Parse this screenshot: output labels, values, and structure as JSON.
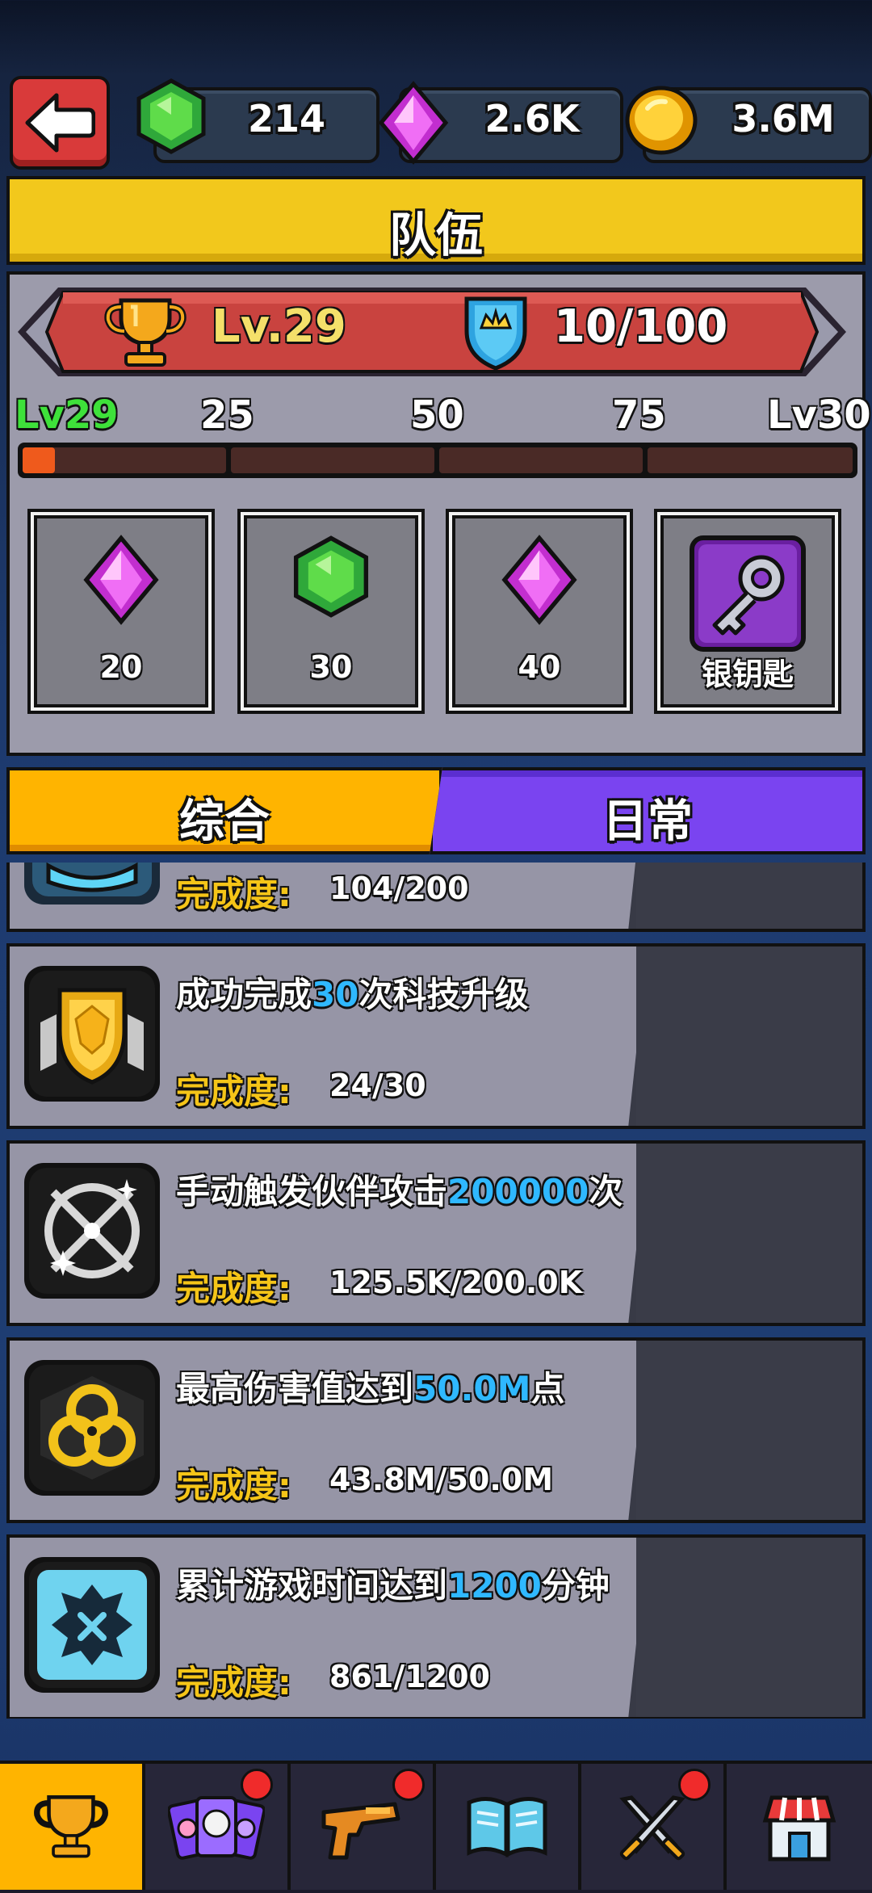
{
  "currencies": {
    "emerald": {
      "value": "214",
      "icon": "green-gem-icon",
      "color": "#3ac24a"
    },
    "crystal": {
      "value": "2.6K",
      "icon": "pink-crystal-icon",
      "color": "#e03ee0"
    },
    "gold": {
      "value": "3.6M",
      "icon": "gold-coin-icon",
      "color": "#f5b400"
    }
  },
  "title": "队伍",
  "team": {
    "level": "Lv.29",
    "points": "10/100",
    "progress_fraction": 0.1,
    "milestones": [
      "Lv29",
      "25",
      "50",
      "75",
      "Lv30"
    ],
    "rewards": [
      {
        "icon": "pink-crystal-icon",
        "label": "20"
      },
      {
        "icon": "green-gem-icon",
        "label": "30"
      },
      {
        "icon": "pink-crystal-icon",
        "label": "40"
      },
      {
        "icon": "silver-key-icon",
        "label": "银钥匙"
      }
    ]
  },
  "tabs": {
    "general": "综合",
    "daily": "日常"
  },
  "quests": [
    {
      "icon": "blue-emblem-icon",
      "title_pre": "",
      "title_hl": "",
      "title_post": "",
      "progress_label": "完成度:",
      "progress": "104/200"
    },
    {
      "icon": "gold-shield-icon",
      "title_pre": "成功完成",
      "title_hl": "30",
      "title_post": "次科技升级",
      "progress_label": "完成度:",
      "progress": "24/30"
    },
    {
      "icon": "crosshair-icon",
      "title_pre": "手动触发伙伴攻击",
      "title_hl": "200000",
      "title_post": "次",
      "progress_label": "完成度:",
      "progress": "125.5K/200.0K"
    },
    {
      "icon": "biohazard-icon",
      "title_pre": "最高伤害值达到",
      "title_hl": "50.0M",
      "title_post": "点",
      "progress_label": "完成度:",
      "progress": "43.8M/50.0M"
    },
    {
      "icon": "clock-x-icon",
      "title_pre": "累计游戏时间达到",
      "title_hl": "1200",
      "title_post": "分钟",
      "progress_label": "完成度:",
      "progress": "861/1200"
    }
  ],
  "nav": [
    {
      "icon": "trophy-icon",
      "active": true,
      "badge": false
    },
    {
      "icon": "hero-cards-icon",
      "active": false,
      "badge": true
    },
    {
      "icon": "pistol-icon",
      "active": false,
      "badge": true
    },
    {
      "icon": "book-icon",
      "active": false,
      "badge": false
    },
    {
      "icon": "crossed-swords-icon",
      "active": false,
      "badge": true
    },
    {
      "icon": "shop-icon",
      "active": false,
      "badge": false
    }
  ]
}
